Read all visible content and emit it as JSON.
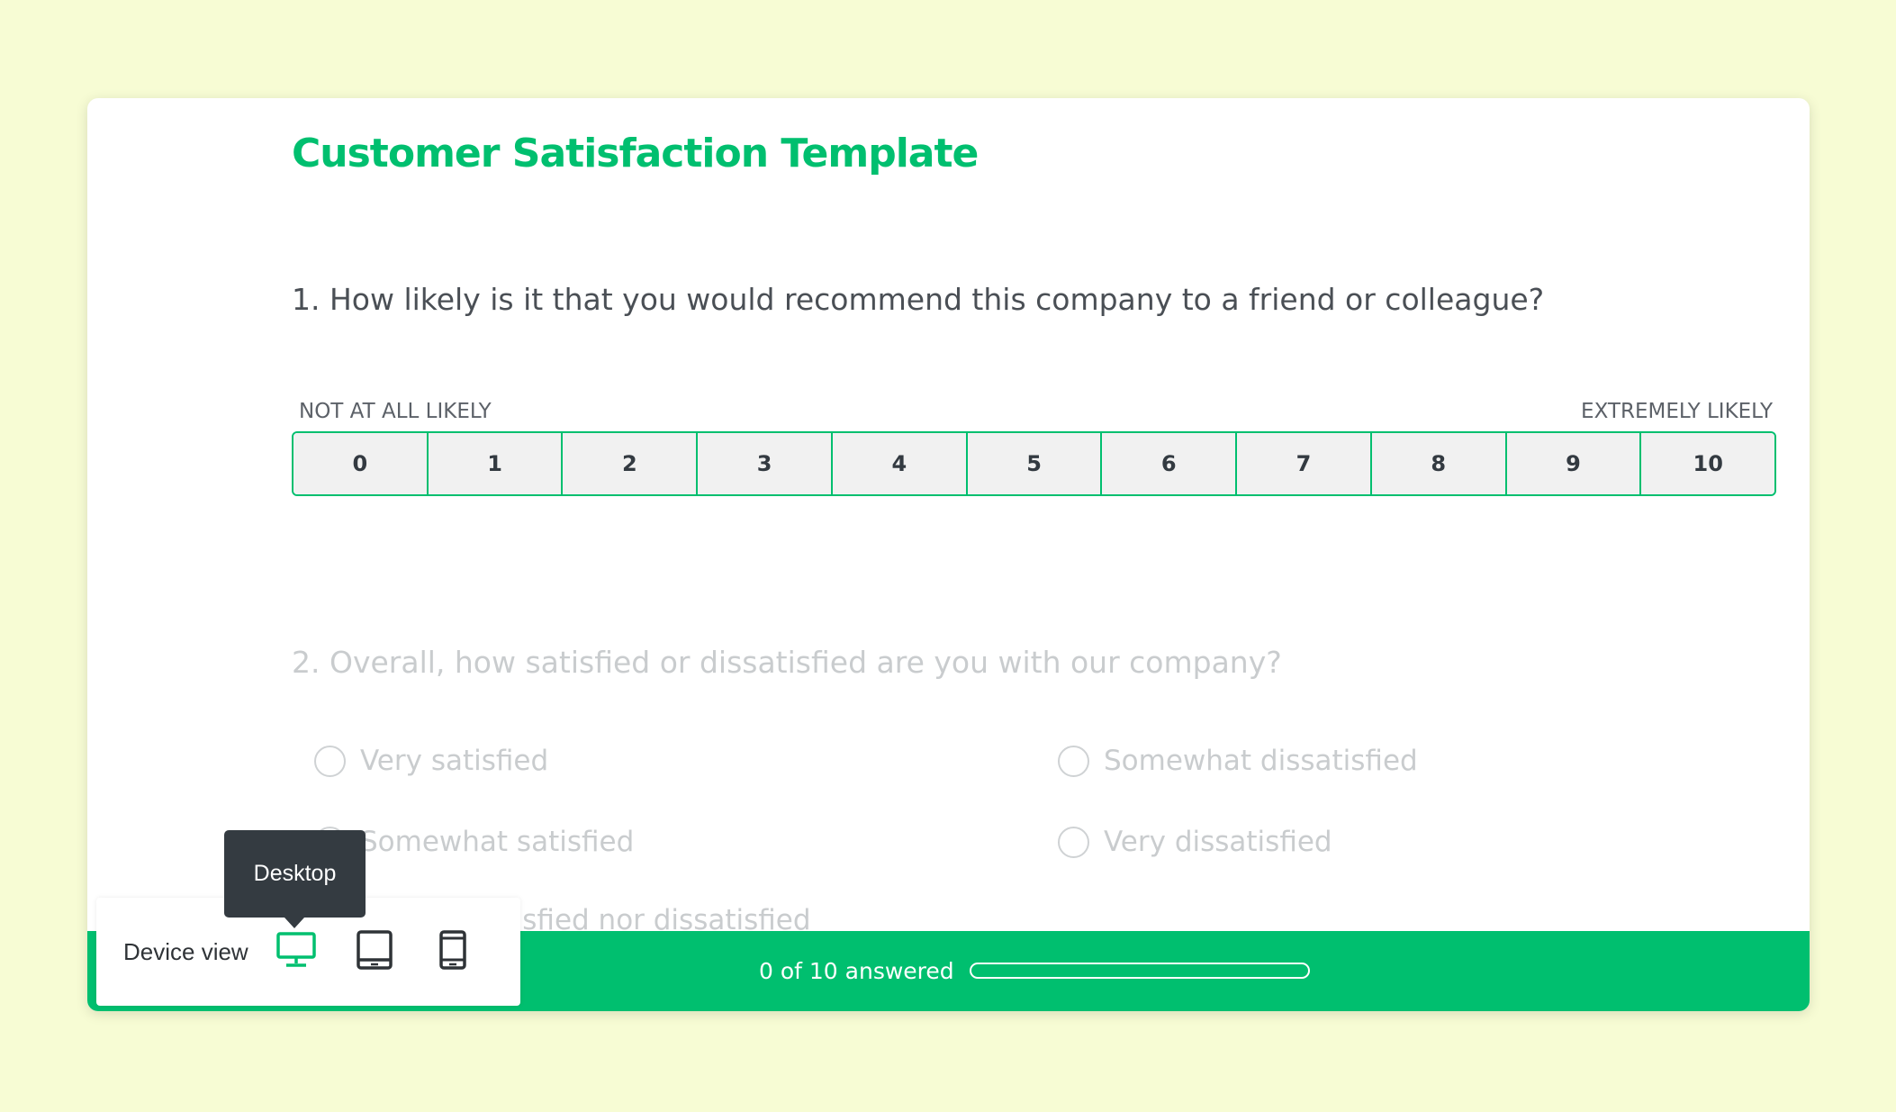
{
  "survey": {
    "title": "Customer Satisfaction Template",
    "questions": [
      {
        "text": "1. How likely is it that you would recommend this company to a friend or colleague?",
        "low_label": "NOT AT ALL LIKELY",
        "high_label": "EXTREMELY LIKELY",
        "scale": [
          "0",
          "1",
          "2",
          "3",
          "4",
          "5",
          "6",
          "7",
          "8",
          "9",
          "10"
        ]
      },
      {
        "text": "2. Overall, how satisfied or dissatisfied are you with our company?",
        "options": [
          "Very satisfied",
          "Somewhat dissatisfied",
          "Somewhat satisfied",
          "Very dissatisfied",
          "Neither satisfied nor dissatisfied"
        ]
      }
    ]
  },
  "progress": {
    "text": "0 of 10 answered",
    "fraction": 0
  },
  "device_view": {
    "label": "Device view",
    "tooltip": "Desktop",
    "selected": "desktop",
    "options": [
      "desktop-icon",
      "tablet-icon",
      "mobile-icon"
    ]
  },
  "colors": {
    "accent": "#00bf6f",
    "background": "#f7fcd4",
    "tooltip": "#343b41"
  }
}
